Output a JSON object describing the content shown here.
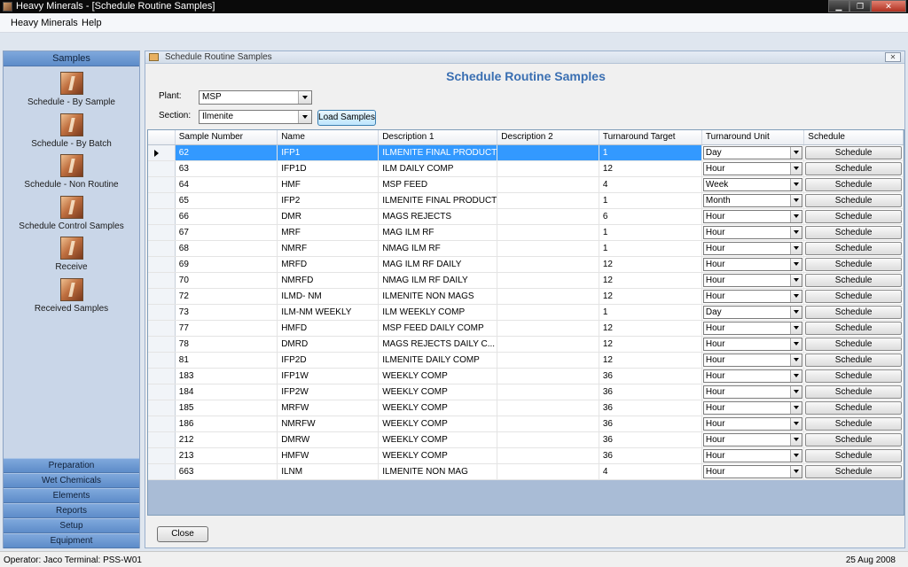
{
  "window": {
    "title": "Heavy Minerals - [Schedule Routine Samples]"
  },
  "menu": {
    "items": [
      "Heavy Minerals",
      "Help"
    ]
  },
  "nav": {
    "header": "Samples",
    "items": [
      "Schedule - By Sample",
      "Schedule - By Batch",
      "Schedule - Non Routine",
      "Schedule Control Samples",
      "Receive",
      "Received Samples"
    ],
    "sections": [
      "Preparation",
      "Wet Chemicals",
      "Elements",
      "Reports",
      "Setup",
      "Equipment"
    ]
  },
  "child": {
    "title": "Schedule Routine Samples",
    "heading": "Schedule Routine Samples",
    "plant_label": "Plant:",
    "plant_value": "MSP",
    "section_label": "Section:",
    "section_value": "Ilmenite",
    "load_button": "Load Samples",
    "close_button": "Close"
  },
  "grid": {
    "columns": [
      "Sample Number",
      "Name",
      "Description 1",
      "Description 2",
      "Turnaround Target",
      "Turnaround Unit",
      "Schedule"
    ],
    "button_label": "Schedule",
    "rows": [
      {
        "num": "62",
        "name": "IFP1",
        "desc1": "ILMENITE FINAL PRODUCT",
        "desc2": "",
        "target": "1",
        "unit": "Day"
      },
      {
        "num": "63",
        "name": "IFP1D",
        "desc1": "ILM DAILY COMP",
        "desc2": "",
        "target": "12",
        "unit": "Hour"
      },
      {
        "num": "64",
        "name": "HMF",
        "desc1": "MSP FEED",
        "desc2": "",
        "target": "4",
        "unit": "Week"
      },
      {
        "num": "65",
        "name": "IFP2",
        "desc1": "ILMENITE FINAL PRODUCT",
        "desc2": "",
        "target": "1",
        "unit": "Month"
      },
      {
        "num": "66",
        "name": "DMR",
        "desc1": "MAGS REJECTS",
        "desc2": "",
        "target": "6",
        "unit": "Hour"
      },
      {
        "num": "67",
        "name": "MRF",
        "desc1": "MAG ILM RF",
        "desc2": "",
        "target": "1",
        "unit": "Hour"
      },
      {
        "num": "68",
        "name": "NMRF",
        "desc1": "NMAG ILM RF",
        "desc2": "",
        "target": "1",
        "unit": "Hour"
      },
      {
        "num": "69",
        "name": "MRFD",
        "desc1": "MAG ILM RF DAILY",
        "desc2": "",
        "target": "12",
        "unit": "Hour"
      },
      {
        "num": "70",
        "name": "NMRFD",
        "desc1": "NMAG ILM RF DAILY",
        "desc2": "",
        "target": "12",
        "unit": "Hour"
      },
      {
        "num": "72",
        "name": "ILMD- NM",
        "desc1": "ILMENITE NON MAGS",
        "desc2": "",
        "target": "12",
        "unit": "Hour"
      },
      {
        "num": "73",
        "name": "ILM-NM WEEKLY",
        "desc1": "ILM WEEKLY COMP",
        "desc2": "",
        "target": "1",
        "unit": "Day"
      },
      {
        "num": "77",
        "name": "HMFD",
        "desc1": "MSP FEED DAILY COMP",
        "desc2": "",
        "target": "12",
        "unit": "Hour"
      },
      {
        "num": "78",
        "name": "DMRD",
        "desc1": "MAGS REJECTS DAILY C...",
        "desc2": "",
        "target": "12",
        "unit": "Hour"
      },
      {
        "num": "81",
        "name": "IFP2D",
        "desc1": "ILMENITE DAILY COMP",
        "desc2": "",
        "target": "12",
        "unit": "Hour"
      },
      {
        "num": "183",
        "name": "IFP1W",
        "desc1": "WEEKLY COMP",
        "desc2": "",
        "target": "36",
        "unit": "Hour"
      },
      {
        "num": "184",
        "name": "IFP2W",
        "desc1": "WEEKLY COMP",
        "desc2": "",
        "target": "36",
        "unit": "Hour"
      },
      {
        "num": "185",
        "name": "MRFW",
        "desc1": "WEEKLY COMP",
        "desc2": "",
        "target": "36",
        "unit": "Hour"
      },
      {
        "num": "186",
        "name": "NMRFW",
        "desc1": "WEEKLY COMP",
        "desc2": "",
        "target": "36",
        "unit": "Hour"
      },
      {
        "num": "212",
        "name": "DMRW",
        "desc1": "WEEKLY COMP",
        "desc2": "",
        "target": "36",
        "unit": "Hour"
      },
      {
        "num": "213",
        "name": "HMFW",
        "desc1": "WEEKLY COMP",
        "desc2": "",
        "target": "36",
        "unit": "Hour"
      },
      {
        "num": "663",
        "name": "ILNM",
        "desc1": "ILMENITE NON MAG",
        "desc2": "",
        "target": "4",
        "unit": "Hour"
      }
    ]
  },
  "status": {
    "operator": "Operator:  Jaco  Terminal:  PSS-W01",
    "date": "25 Aug 2008"
  }
}
